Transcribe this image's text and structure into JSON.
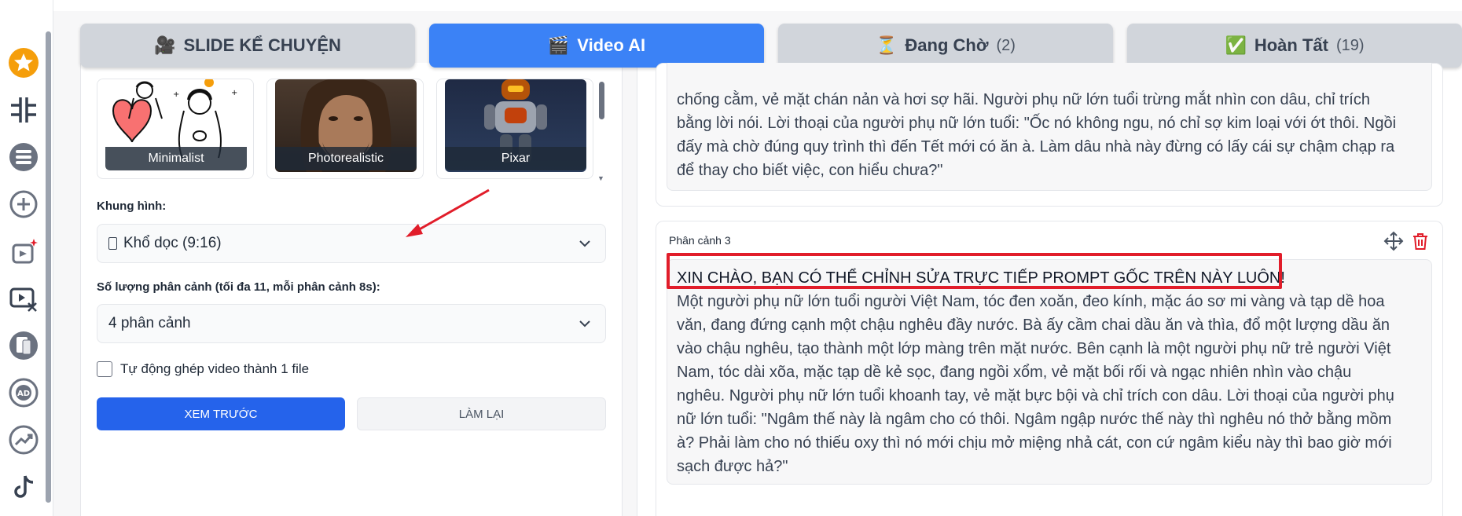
{
  "tabs": [
    {
      "label": "SLIDE KỂ CHUYỆN",
      "icon": "video-camera-icon",
      "active": false
    },
    {
      "label": "Video AI",
      "icon": "clapperboard-icon",
      "active": true
    },
    {
      "label": "Đang Chờ",
      "count": "(2)",
      "icon": "hourglass-icon",
      "active": false
    },
    {
      "label": "Hoàn Tất",
      "count": "(19)",
      "icon": "checkmark-icon",
      "active": false
    }
  ],
  "sidebar_icons": [
    "star-icon",
    "logo-icon",
    "stack-icon",
    "add-icon",
    "image-sparkle-icon",
    "video-edit-icon",
    "document-icon",
    "ad-icon",
    "trend-icon",
    "tiktok-icon"
  ],
  "styles": [
    {
      "caption": "Minimalist"
    },
    {
      "caption": "Photorealistic"
    },
    {
      "caption": "Pixar"
    }
  ],
  "frame": {
    "label": "Khung hình:",
    "value": "Khổ dọc (9:16)"
  },
  "scenes_count": {
    "label": "Số lượng phân cảnh (tối đa 11, mỗi phân cảnh 8s):",
    "value": "4 phân cảnh"
  },
  "auto_merge": {
    "label": "Tự động ghép video thành 1 file",
    "checked": false
  },
  "buttons": {
    "preview": "XEM TRƯỚC",
    "reset": "LÀM LẠI"
  },
  "scene_prev": {
    "lines": [
      "chống cằm, vẻ mặt chán nản và hơi sợ hãi. Người phụ nữ lớn tuổi trừng mắt nhìn con dâu, chỉ trích",
      "bằng lời nói. Lời thoại của người phụ nữ lớn tuổi: \"Ốc nó không ngu, nó chỉ sợ kim loại với ớt thôi. Ngồi",
      "đấy mà chờ đúng quy trình thì đến Tết mới có ăn à. Làm dâu nhà này đừng có lấy cái sự chậm chạp ra",
      "để thay cho biết việc, con hiểu chưa?\""
    ]
  },
  "scene3": {
    "title": "Phân cảnh 3",
    "prompt": "XIN CHÀO, BẠN CÓ THỂ CHỈNH SỬA TRỰC TIẾP PROMPT GỐC TRÊN NÀY LUÔN!",
    "lines": [
      "Một người phụ nữ lớn tuổi người Việt Nam, tóc đen xoăn, đeo kính, mặc áo sơ mi vàng và tạp dề hoa",
      "văn, đang đứng cạnh một chậu nghêu đầy nước. Bà ấy cầm chai dầu ăn và thìa, đổ một lượng dầu ăn",
      "vào chậu nghêu, tạo thành một lớp màng trên mặt nước. Bên cạnh là một người phụ nữ trẻ người Việt",
      "Nam, tóc dài xõa, mặc tạp dề kẻ sọc, đang ngồi xổm, vẻ mặt bối rối và ngạc nhiên nhìn vào chậu",
      "nghêu. Người phụ nữ lớn tuổi khoanh tay, vẻ mặt bực bội và chỉ trích con dâu. Lời thoại của người phụ",
      "nữ lớn tuổi: \"Ngâm thế này là ngâm cho có thôi. Ngâm ngập nước thế này thì nghêu nó thở bằng mồm",
      "à? Phải làm cho nó thiếu oxy thì nó mới chịu mở miệng nhả cát, con cứ ngâm kiểu này thì bao giờ mới",
      "sạch được hả?\""
    ]
  },
  "colors": {
    "primary": "#2563eb",
    "active_tab": "#3b82f6",
    "annotation": "#e11d2a",
    "delete": "#e11d2a"
  }
}
